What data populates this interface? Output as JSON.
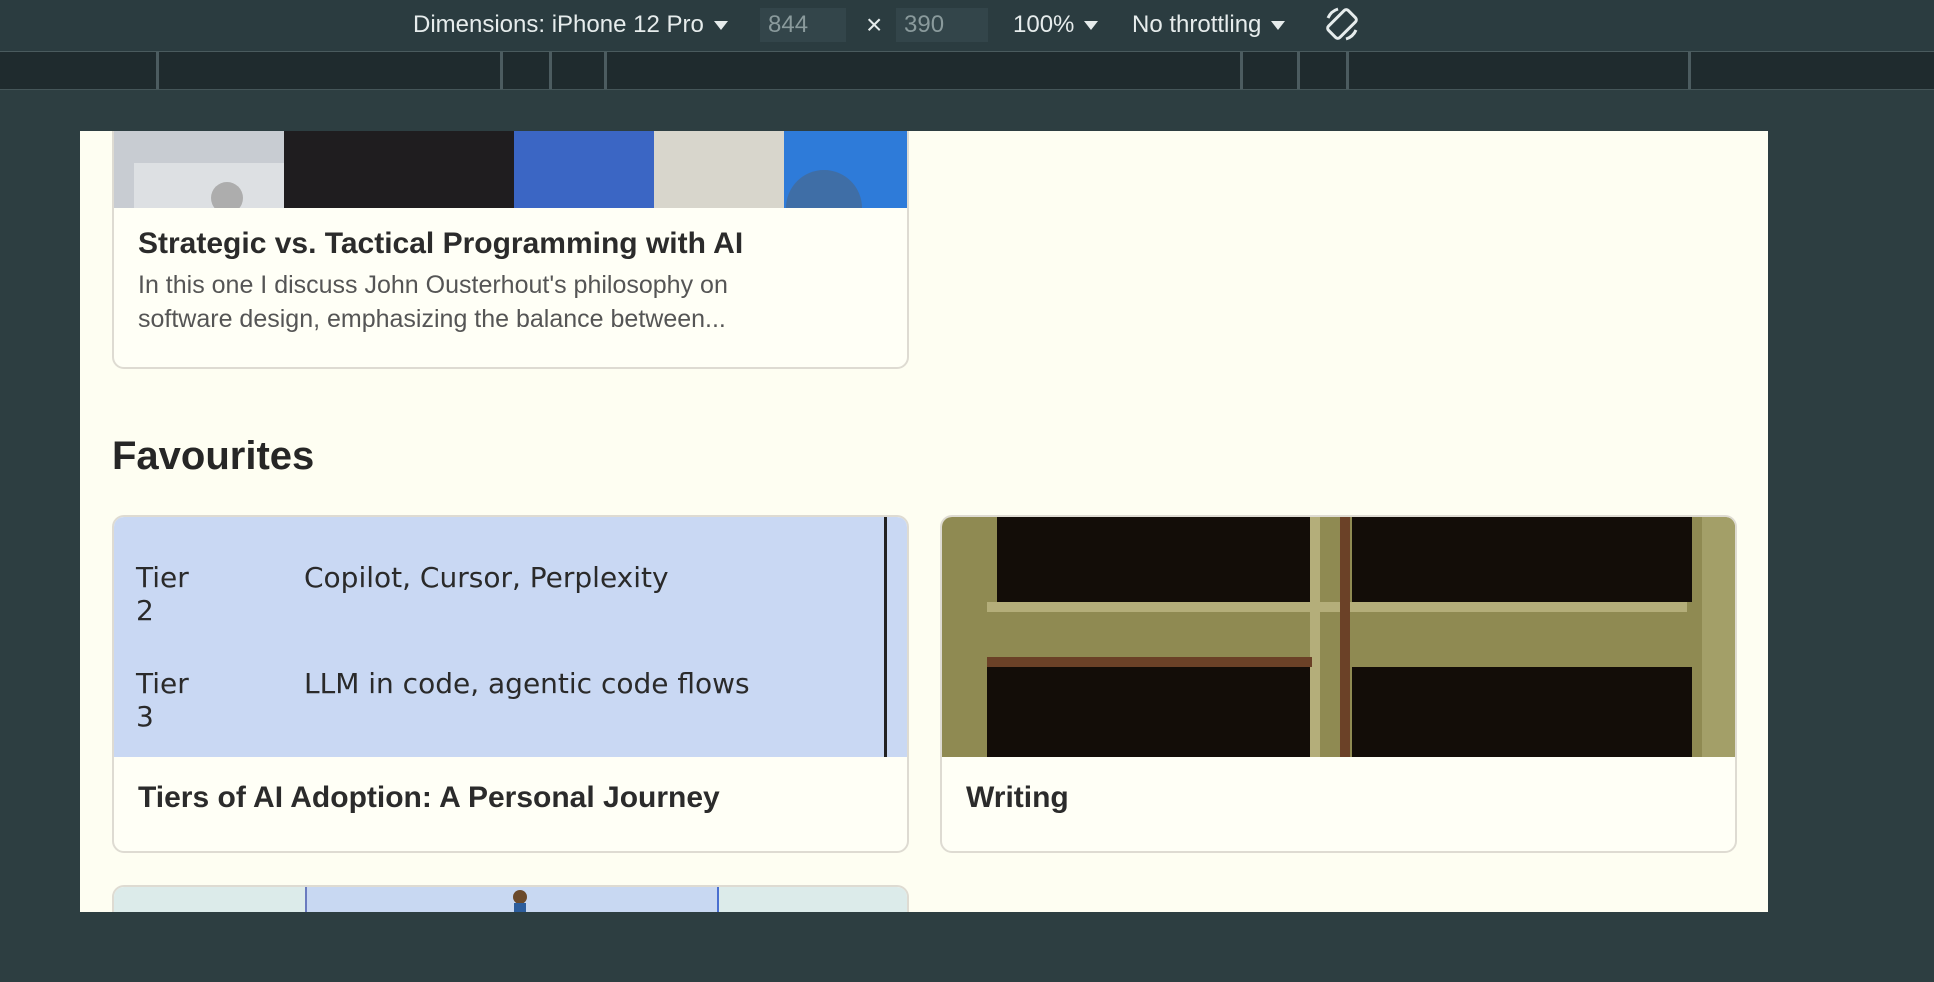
{
  "devtools": {
    "dimensions_label": "Dimensions: iPhone 12 Pro",
    "width_value": "844",
    "height_value": "390",
    "times_symbol": "×",
    "zoom": "100%",
    "throttling": "No throttling",
    "icons": [
      "chevron-down-icon",
      "rotate-icon"
    ]
  },
  "page": {
    "cards_top": [
      {
        "title": "Strategic vs. Tactical Programming with AI",
        "description_line1": "In this one I discuss John Ousterhout's philosophy on",
        "description_line2": "software design, emphasizing the balance between..."
      }
    ],
    "favourites": {
      "heading": "Favourites",
      "cards": [
        {
          "title": "Tiers of AI Adoption: A Personal Journey",
          "thumbnail_rows": [
            {
              "tier": "Tier 2",
              "tools": "Copilot, Cursor, Perplexity"
            },
            {
              "tier": "Tier 3",
              "tools": "LLM in code, agentic code flows"
            }
          ]
        },
        {
          "title": "Writing"
        }
      ]
    }
  },
  "colors": {
    "page_bg": "#fefef2",
    "devtools_bg": "#2b3c40",
    "tiers_thumb_bg": "#c9d8f3",
    "writing_thumb_frame": "#8f8a52"
  }
}
